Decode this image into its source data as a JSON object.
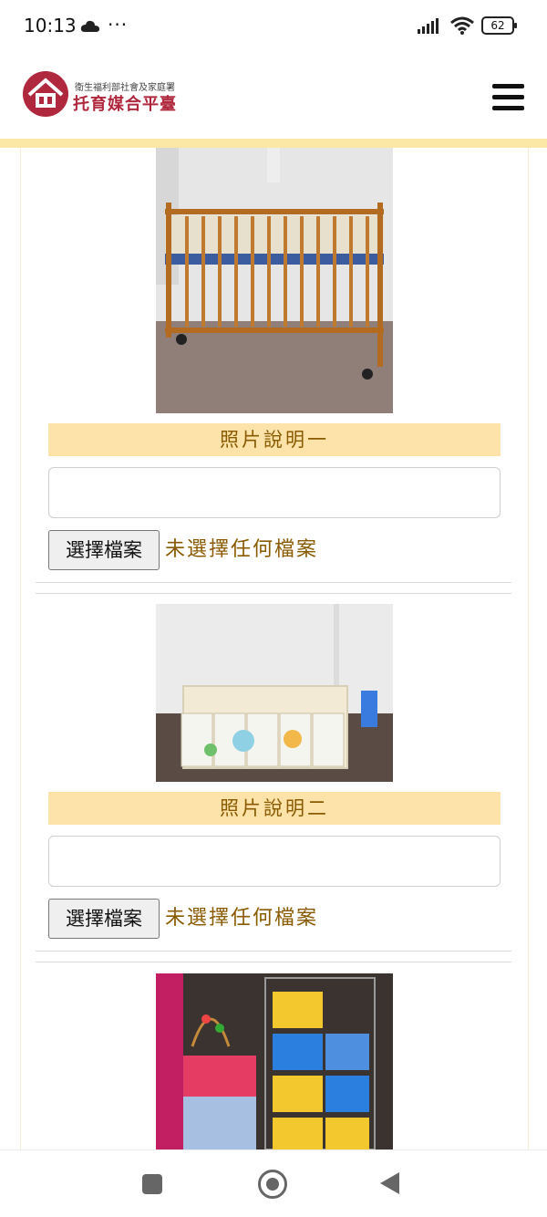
{
  "status_bar": {
    "time": "10:13",
    "dots": "···",
    "battery": "62"
  },
  "header": {
    "logo_subtitle": "衛生福利部社會及家庭署",
    "logo_title": "托育媒合平臺",
    "brand_color": "#b0283e",
    "accent_color": "#fbe7a6"
  },
  "photos": [
    {
      "image": "wooden-crib-photo",
      "caption": "照片說明一",
      "description_value": "",
      "file_button_label": "選擇檔案",
      "file_status": "未選擇任何檔案"
    },
    {
      "image": "play-yard-fence-photo",
      "caption": "照片說明二",
      "description_value": "",
      "file_button_label": "選擇檔案",
      "file_status": "未選擇任何檔案"
    },
    {
      "image": "toy-storage-shelf-photo"
    }
  ],
  "nav_bar": {
    "icons": [
      "recent-apps-icon",
      "home-icon",
      "back-icon"
    ]
  }
}
